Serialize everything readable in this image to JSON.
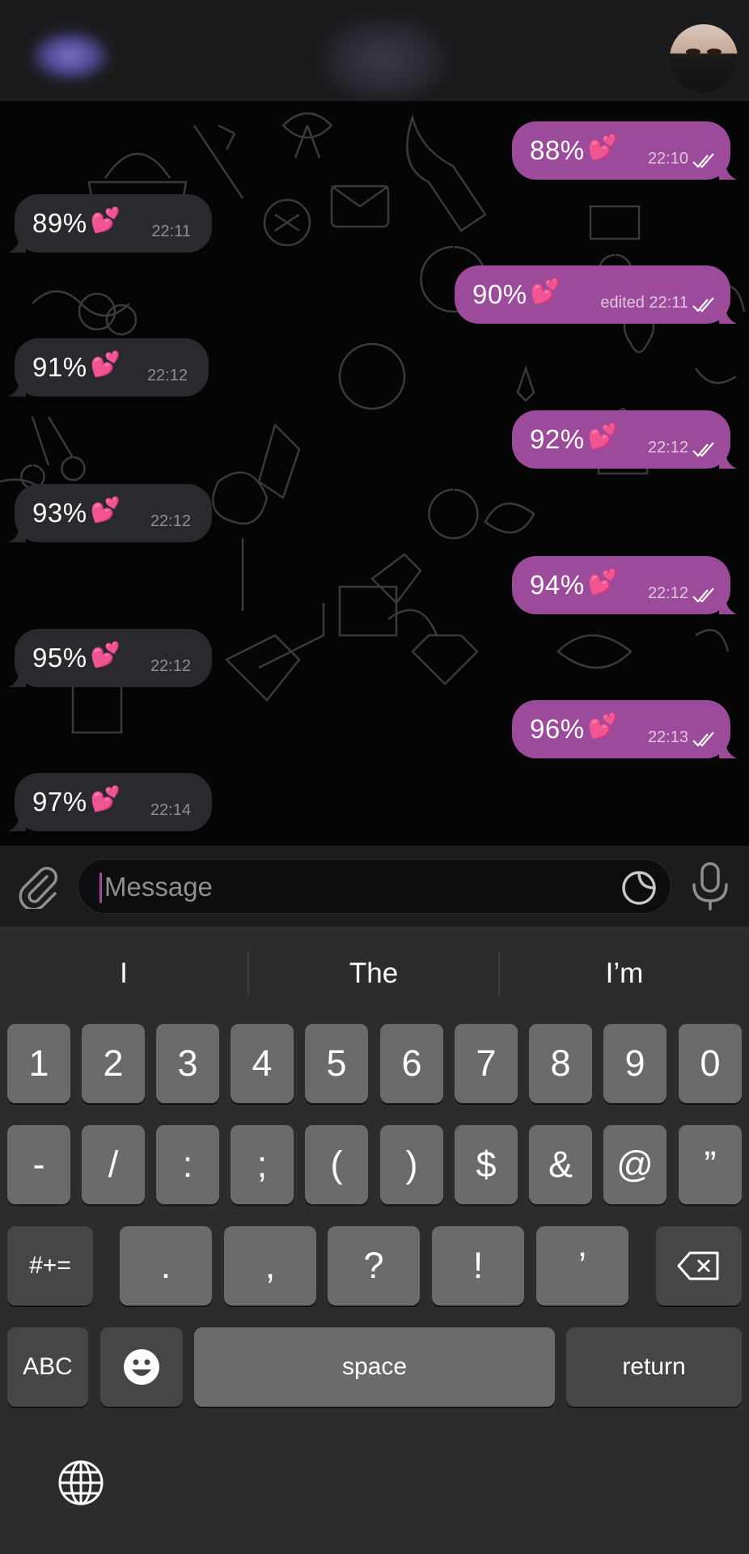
{
  "header": {
    "avatar": "avatar-photo"
  },
  "messages": [
    {
      "side": "out",
      "text": "88%",
      "emoji": "💕",
      "time": "22:10",
      "status": "read"
    },
    {
      "side": "in",
      "text": "89%",
      "emoji": "💕",
      "time": "22:11"
    },
    {
      "side": "out",
      "text": "90%",
      "emoji": "💕",
      "time": "edited 22:11",
      "status": "read"
    },
    {
      "side": "in",
      "text": "91%",
      "emoji": "💕",
      "time": "22:12"
    },
    {
      "side": "out",
      "text": "92%",
      "emoji": "💕",
      "time": "22:12",
      "status": "read"
    },
    {
      "side": "in",
      "text": "93%",
      "emoji": "💕",
      "time": "22:12"
    },
    {
      "side": "out",
      "text": "94%",
      "emoji": "💕",
      "time": "22:12",
      "status": "read"
    },
    {
      "side": "in",
      "text": "95%",
      "emoji": "💕",
      "time": "22:12"
    },
    {
      "side": "out",
      "text": "96%",
      "emoji": "💕",
      "time": "22:13",
      "status": "read"
    },
    {
      "side": "in",
      "text": "97%",
      "emoji": "💕",
      "time": "22:14"
    }
  ],
  "composer": {
    "placeholder": "Message",
    "value": ""
  },
  "keyboard": {
    "suggestions": [
      "I",
      "The",
      "I’m"
    ],
    "row1": [
      "1",
      "2",
      "3",
      "4",
      "5",
      "6",
      "7",
      "8",
      "9",
      "0"
    ],
    "row2": [
      "-",
      "/",
      ":",
      ";",
      "(",
      ")",
      "$",
      "&",
      "@",
      "”"
    ],
    "row3_mode": "#+=",
    "row3": [
      ".",
      ",",
      "?",
      "!",
      "’"
    ],
    "abc": "ABC",
    "space": "space",
    "return": "return"
  },
  "colors": {
    "outgoing_bubble": "#9c4b9a",
    "incoming_bubble": "#2a2a2e",
    "keyboard_bg": "#2c2c2e"
  }
}
